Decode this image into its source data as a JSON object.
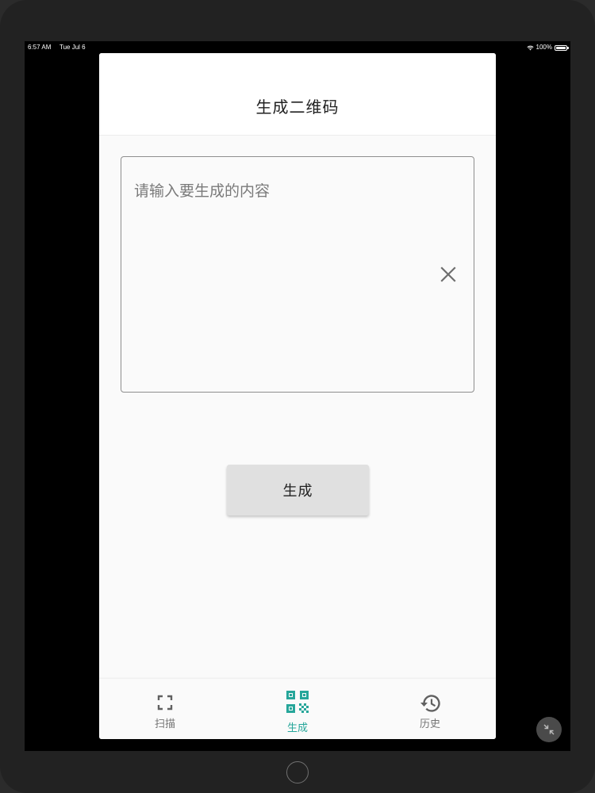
{
  "status_bar": {
    "time": "6:57 AM",
    "date": "Tue Jul 6",
    "battery": "100%",
    "battery_level": 1.0
  },
  "app_bar": {
    "title": "生成二维码"
  },
  "input": {
    "placeholder": "请输入要生成的内容",
    "value": ""
  },
  "generate_button": {
    "label": "生成"
  },
  "bottom_nav": {
    "items": [
      {
        "label": "扫描",
        "icon": "scan-frame-icon",
        "active": false
      },
      {
        "label": "生成",
        "icon": "qr-code-icon",
        "active": true
      },
      {
        "label": "历史",
        "icon": "history-icon",
        "active": false
      }
    ]
  },
  "colors": {
    "accent": "#26a69a",
    "inactive": "#757575",
    "button_bg": "#e0e0e0",
    "app_bar_bg": "#ffffff",
    "body_bg": "#fafafa"
  }
}
